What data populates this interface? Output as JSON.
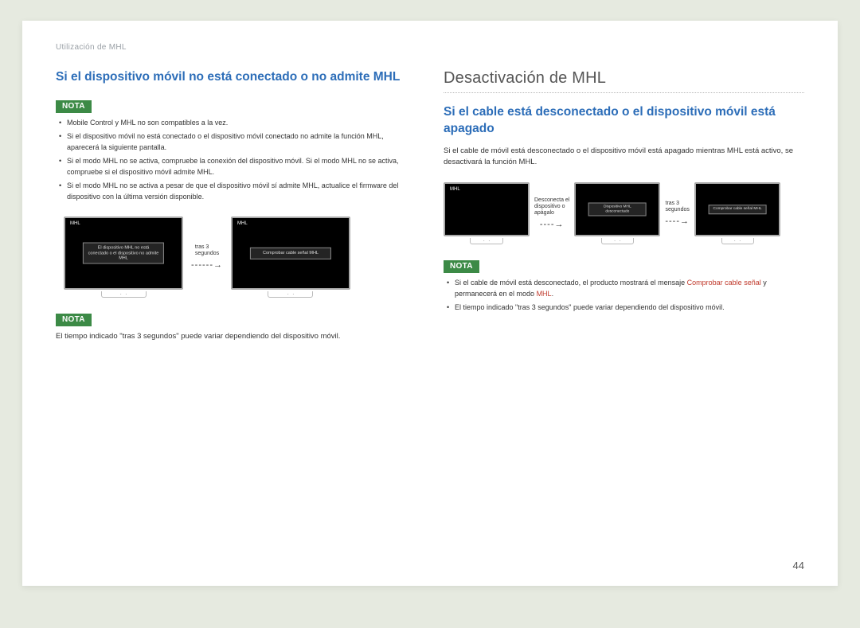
{
  "breadcrumb": "Utilización de MHL",
  "pageNumber": "44",
  "left": {
    "h1": "Si el dispositivo móvil no está conectado o no admite MHL",
    "notaLabel": "NOTA",
    "notes1": [
      "Mobile Control y MHL no son compatibles a la vez.",
      "Si el dispositivo móvil no está conectado o el dispositivo móvil conectado no admite la función MHL, aparecerá la siguiente pantalla.",
      "Si el modo MHL no se activa, compruebe la conexión del dispositivo móvil. Si el modo MHL no se activa, compruebe si el dispositivo móvil admite MHL.",
      "Si el modo MHL no se activa a pesar de que el dispositivo móvil sí admite MHL, actualice el firmware del dispositivo con la última versión disponible."
    ],
    "fig": {
      "monitor1": {
        "label": "MHL",
        "msg": "El dispositivo MHL no está conectado o el dispositivo no admite MHL"
      },
      "arrowText": "tras 3\nsegundos",
      "monitor2": {
        "label": "MHL",
        "msg": "Comprobar cable señal MHL"
      }
    },
    "note2": "El tiempo indicado \"tras 3 segundos\" puede variar dependiendo del dispositivo móvil."
  },
  "right": {
    "sectionTitle": "Desactivación de MHL",
    "h1": "Si el cable está desconectado o el dispositivo móvil está apagado",
    "intro": "Si el cable de móvil está desconectado o el dispositivo móvil está apagado mientras MHL está activo, se desactivará la función MHL.",
    "fig": {
      "monitor1": {
        "label": "MHL",
        "msg": ""
      },
      "arrow1Text": "Desconecta el\ndispositivo o\napágalo",
      "monitor2": {
        "label": "",
        "msg": "Dispositivo MHL desconectado"
      },
      "arrow2Text": "tras 3\nsegundos",
      "monitor3": {
        "label": "",
        "msg": "Comprobar cable señal MHL"
      }
    },
    "notaLabel": "NOTA",
    "notes": {
      "n1_pre": "Si el cable de móvil está desconectado, el producto mostrará el mensaje ",
      "n1_red1": "Comprobar cable señal",
      "n1_mid": " y permanecerá en el modo ",
      "n1_red2": "MHL",
      "n1_post": ".",
      "n2": "El tiempo indicado \"tras 3 segundos\" puede variar dependiendo del dispositivo móvil."
    }
  }
}
